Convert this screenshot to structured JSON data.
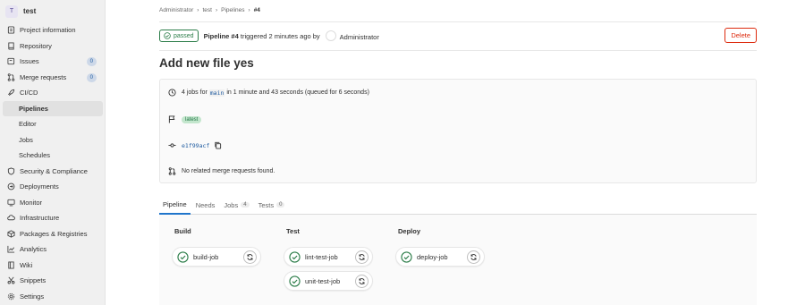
{
  "project": {
    "avatar_letter": "T",
    "name": "test"
  },
  "sidebar": {
    "items": [
      {
        "label": "Project information",
        "icon": "info-icon"
      },
      {
        "label": "Repository",
        "icon": "repository-icon"
      },
      {
        "label": "Issues",
        "icon": "issues-icon",
        "count": "0"
      },
      {
        "label": "Merge requests",
        "icon": "merge-request-icon",
        "count": "0"
      },
      {
        "label": "CI/CD",
        "icon": "rocket-icon"
      },
      {
        "label": "Pipelines",
        "sub": true,
        "active": true
      },
      {
        "label": "Editor",
        "sub": true
      },
      {
        "label": "Jobs",
        "sub": true
      },
      {
        "label": "Schedules",
        "sub": true
      },
      {
        "label": "Security & Compliance",
        "icon": "shield-icon"
      },
      {
        "label": "Deployments",
        "icon": "deployments-icon"
      },
      {
        "label": "Monitor",
        "icon": "monitor-icon"
      },
      {
        "label": "Infrastructure",
        "icon": "cloud-icon"
      },
      {
        "label": "Packages & Registries",
        "icon": "package-icon"
      },
      {
        "label": "Analytics",
        "icon": "chart-icon"
      },
      {
        "label": "Wiki",
        "icon": "book-icon"
      },
      {
        "label": "Snippets",
        "icon": "scissors-icon"
      },
      {
        "label": "Settings",
        "icon": "gear-icon"
      }
    ]
  },
  "breadcrumb": {
    "items": [
      "Administrator",
      "test",
      "Pipelines"
    ],
    "current": "#4",
    "separator": "›"
  },
  "header": {
    "status": "passed",
    "pipeline_label": "Pipeline #4",
    "triggered_text": "triggered 2 minutes ago by",
    "user": "Administrator",
    "delete_label": "Delete"
  },
  "commit_title": "Add new file yes",
  "info": {
    "jobs_prefix": "4 jobs for",
    "branch": "main",
    "jobs_suffix": "in 1 minute and 43 seconds (queued for 6 seconds)",
    "tag": "latest",
    "sha": "e1f99acf",
    "merge_requests": "No related merge requests found."
  },
  "tabs": [
    {
      "label": "Pipeline",
      "active": true
    },
    {
      "label": "Needs"
    },
    {
      "label": "Jobs",
      "count": "4"
    },
    {
      "label": "Tests",
      "count": "0"
    }
  ],
  "stages": [
    {
      "name": "Build",
      "jobs": [
        "build-job"
      ]
    },
    {
      "name": "Test",
      "jobs": [
        "lint-test-job",
        "unit-test-job"
      ]
    },
    {
      "name": "Deploy",
      "jobs": [
        "deploy-job"
      ]
    }
  ],
  "colors": {
    "success": "#2c7d49",
    "danger": "#dd2b0e",
    "link": "#1f5ba0",
    "tab_active": "#1f75cb"
  }
}
